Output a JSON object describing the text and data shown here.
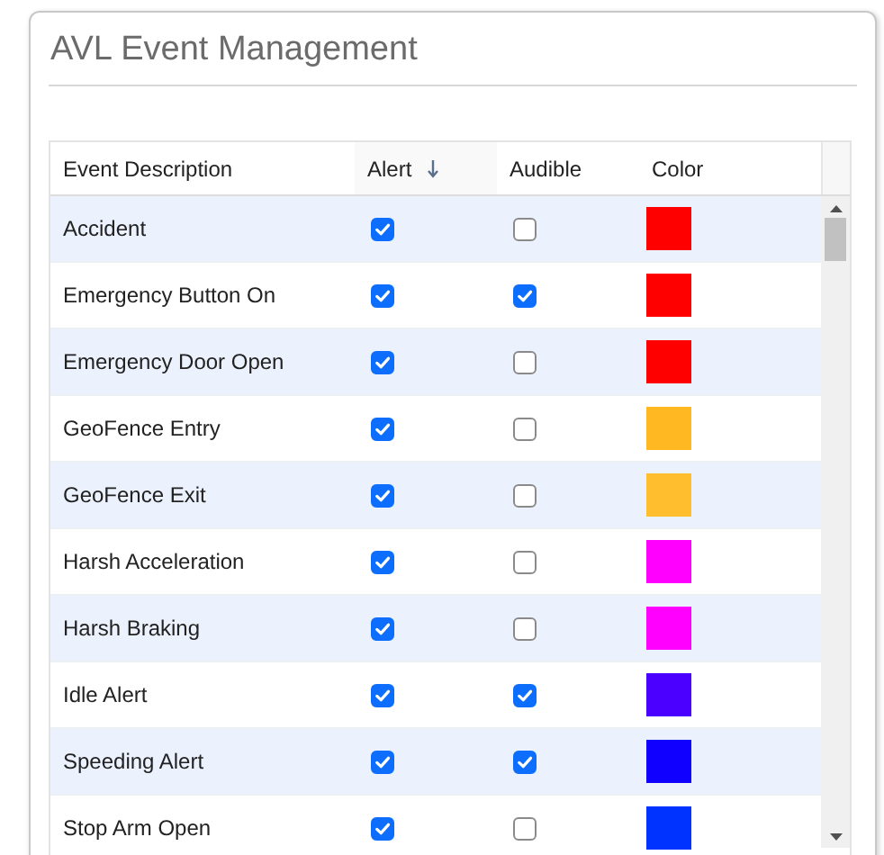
{
  "title": "AVL Event Management",
  "table": {
    "columns": [
      {
        "label": "Event Description",
        "sorted": false
      },
      {
        "label": "Alert",
        "sorted": true
      },
      {
        "label": "Audible",
        "sorted": false
      },
      {
        "label": "Color",
        "sorted": false
      }
    ],
    "rows": [
      {
        "event": "Accident",
        "alert": true,
        "audible": false,
        "color": "#ff0000"
      },
      {
        "event": "Emergency Button On",
        "alert": true,
        "audible": true,
        "color": "#ff0000"
      },
      {
        "event": "Emergency Door Open",
        "alert": true,
        "audible": false,
        "color": "#ff0000"
      },
      {
        "event": "GeoFence Entry",
        "alert": true,
        "audible": false,
        "color": "#ffb822"
      },
      {
        "event": "GeoFence Exit",
        "alert": true,
        "audible": false,
        "color": "#ffbe2e"
      },
      {
        "event": "Harsh Acceleration",
        "alert": true,
        "audible": false,
        "color": "#ff00ff"
      },
      {
        "event": "Harsh Braking",
        "alert": true,
        "audible": false,
        "color": "#ff00ff"
      },
      {
        "event": "Idle Alert",
        "alert": true,
        "audible": true,
        "color": "#4b00ff"
      },
      {
        "event": "Speeding Alert",
        "alert": true,
        "audible": true,
        "color": "#1000ff"
      },
      {
        "event": "Stop Arm Open",
        "alert": true,
        "audible": false,
        "color": "#0033ff"
      }
    ]
  }
}
